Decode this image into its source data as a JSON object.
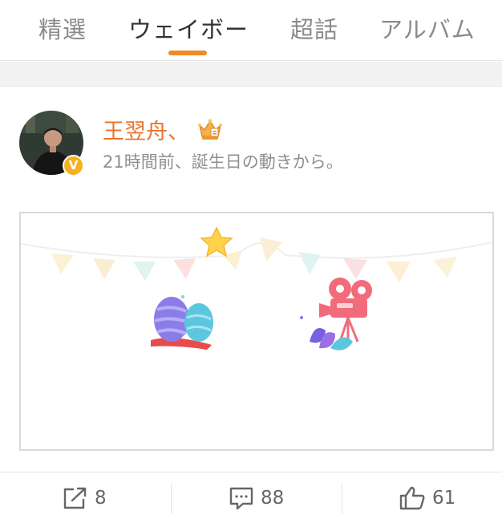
{
  "tabs": [
    {
      "label": "精選",
      "active": false
    },
    {
      "label": "ウェイボー",
      "active": true
    },
    {
      "label": "超話",
      "active": false
    },
    {
      "label": "アルバム",
      "active": false
    }
  ],
  "accent_color": "#f08a24",
  "post": {
    "username": "王翌舟、",
    "meta": "21時間前、誕生日の動きから。",
    "verified_badge": "V",
    "badge_icon": "crown-icon"
  },
  "actions": {
    "repost": {
      "icon": "share-icon",
      "count": "8"
    },
    "comment": {
      "icon": "comment-icon",
      "count": "88"
    },
    "like": {
      "icon": "thumbs-up-icon",
      "count": "61"
    }
  }
}
